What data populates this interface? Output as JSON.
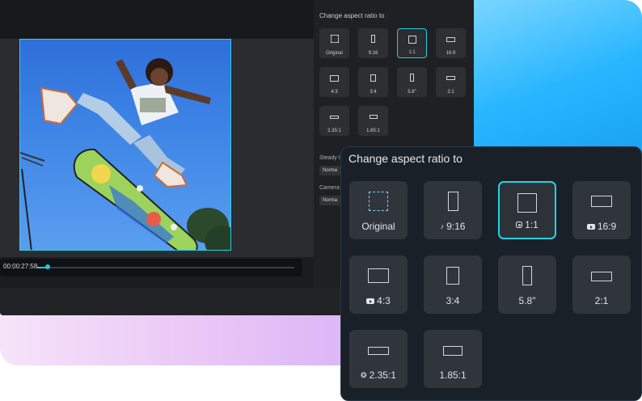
{
  "editor": {
    "timecode": "00:00:27:58",
    "progress_fraction": 0.04
  },
  "side_panel": {
    "title": "Change aspect ratio to",
    "options": [
      {
        "label": "Original"
      },
      {
        "label": "9:16",
        "icon": "tiktok-icon"
      },
      {
        "label": "1:1",
        "icon": "instagram-icon",
        "selected": true
      },
      {
        "label": "16:9",
        "icon": "youtube-icon"
      },
      {
        "label": "4:3",
        "icon": "youtube-icon"
      },
      {
        "label": "3:4"
      },
      {
        "label": "5.8\""
      },
      {
        "label": "2:1"
      },
      {
        "label": "2.35:1",
        "icon": "film-reel-icon"
      },
      {
        "label": "1.85:1"
      }
    ],
    "steady_label": "Steady l",
    "steady_value": "Norma",
    "camera_label": "Camera",
    "camera_value": "Norma"
  },
  "panel": {
    "title": "Change aspect ratio to",
    "options": [
      {
        "label": "Original"
      },
      {
        "label": "9:16",
        "icon": "tiktok-icon"
      },
      {
        "label": "1:1",
        "icon": "instagram-icon",
        "selected": true
      },
      {
        "label": "16:9",
        "icon": "youtube-icon"
      },
      {
        "label": "4:3",
        "icon": "youtube-icon"
      },
      {
        "label": "3:4"
      },
      {
        "label": "5.8\""
      },
      {
        "label": "2:1"
      },
      {
        "label": "2.35:1",
        "icon": "film-reel-icon"
      },
      {
        "label": "1.85:1"
      }
    ]
  },
  "colors": {
    "accent": "#22d3e6",
    "panel_bg": "#1a2027",
    "card_bg": "#30353b"
  }
}
